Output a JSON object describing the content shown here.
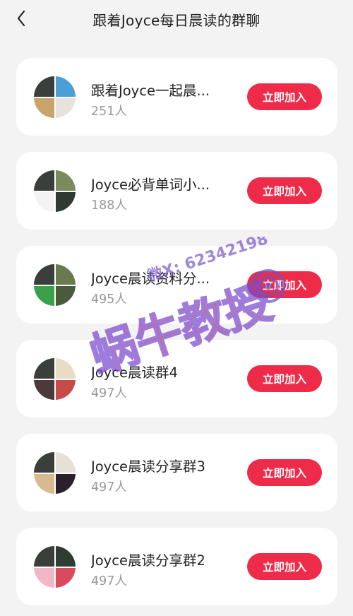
{
  "header": {
    "title": "跟着Joyce每日晨读的群聊",
    "back_icon": "chevron-left-icon"
  },
  "groups": [
    {
      "name": "跟着Joyce一起晨...",
      "count": "251人",
      "join_label": "立即加入",
      "avatars": [
        "#3a3f3b",
        "#4aa0d6",
        "#c9a36a",
        "#e9e2dc"
      ]
    },
    {
      "name": "Joyce必背单词小...",
      "count": "188人",
      "join_label": "立即加入",
      "avatars": [
        "#3a3f3b",
        "#7a8a5a",
        "#f3f3f3",
        "#2f3a33"
      ]
    },
    {
      "name": "Joyce晨读资料分...",
      "count": "495人",
      "join_label": "立即加入",
      "avatars": [
        "#3a3f3b",
        "#6b7a4e",
        "#3aa04a",
        "#4a5a3c"
      ]
    },
    {
      "name": "Joyce晨读群4",
      "count": "497人",
      "join_label": "立即加入",
      "avatars": [
        "#3a3f3b",
        "#e8dcc4",
        "#4c3a3a",
        "#c84b4b"
      ]
    },
    {
      "name": "Joyce晨读分享群3",
      "count": "497人",
      "join_label": "立即加入",
      "avatars": [
        "#3a3f3b",
        "#e6e1d8",
        "#d9b98f",
        "#2a1f2a"
      ]
    },
    {
      "name": "Joyce晨读分享群2",
      "count": "497人",
      "join_label": "立即加入",
      "avatars": [
        "#3a3f3b",
        "#2e3d33",
        "#f2b7c6",
        "#d94a5c"
      ]
    }
  ],
  "colors": {
    "accent": "#ee2c4a",
    "background": "#f3f3f3",
    "card": "#ffffff"
  },
  "watermark": {
    "main": "蜗牛教授",
    "contact": "微X: 62342198"
  }
}
